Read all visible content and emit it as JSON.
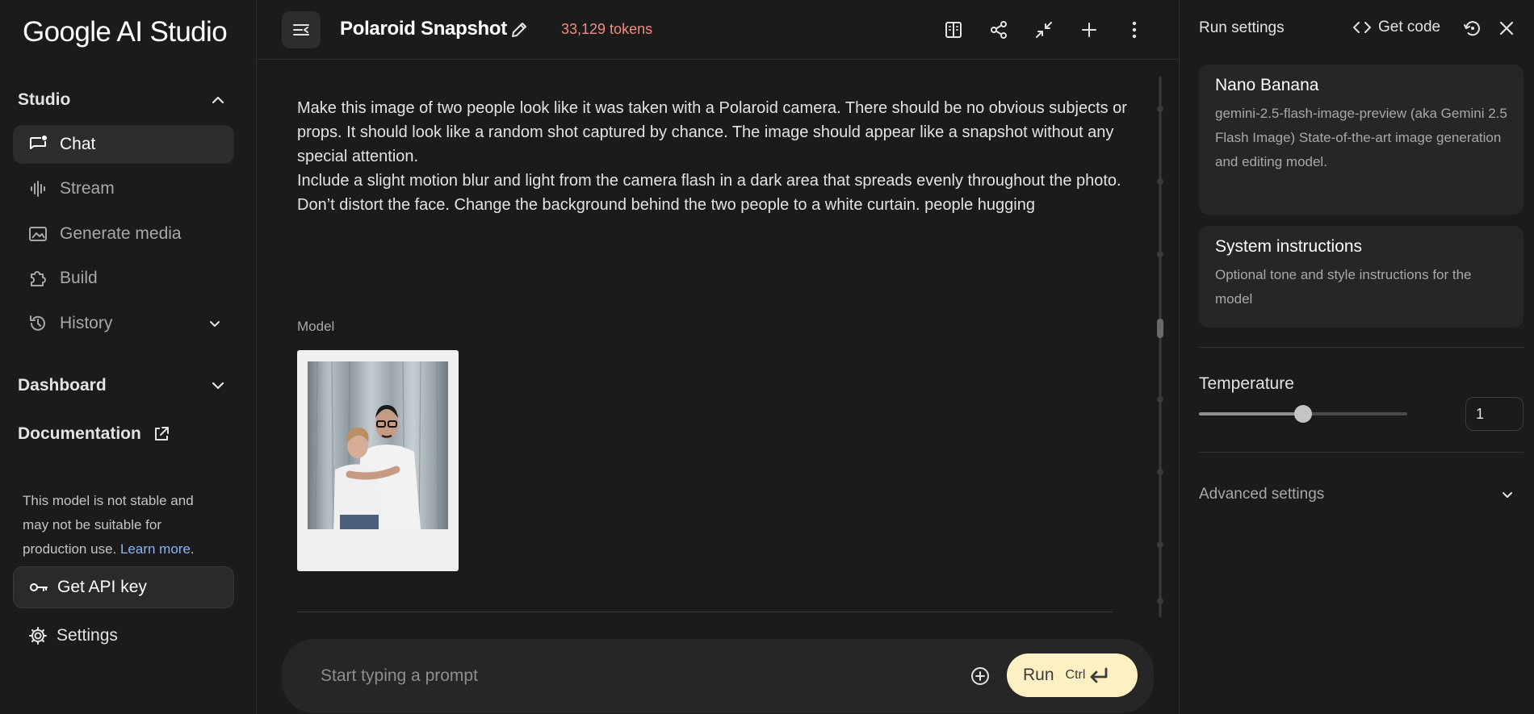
{
  "app": {
    "logo_text": "Google AI Studio"
  },
  "sidebar": {
    "studio_label": "Studio",
    "items": [
      {
        "label": "Chat",
        "icon": "chat-icon",
        "active": true
      },
      {
        "label": "Stream",
        "icon": "stream-icon"
      },
      {
        "label": "Generate media",
        "icon": "image-icon"
      },
      {
        "label": "Build",
        "icon": "puzzle-icon"
      },
      {
        "label": "History",
        "icon": "history-icon"
      }
    ],
    "dashboard_label": "Dashboard",
    "documentation_label": "Documentation",
    "notice_text": "This model is not stable and may not be suitable for production use. ",
    "notice_link": "Learn more",
    "notice_period": ".",
    "api_key_label": "Get API key",
    "settings_label": "Settings"
  },
  "topbar": {
    "title": "Polaroid Snapshot",
    "tokens": "33,129 tokens",
    "actions": [
      "compare-icon",
      "share-icon",
      "collapse-icon",
      "add-icon",
      "more-vert-icon"
    ]
  },
  "chat": {
    "prompt_lines": [
      "Make this image of two people look like it was taken with a Polaroid camera. There should be no obvious subjects or props. It should look like a random shot captured by chance. The image should appear like a snapshot without any special attention.",
      "Include a slight motion blur and light from the camera flash in a dark area that spreads evenly throughout the photo. Don’t distort the face. Change the background behind the two people to a white curtain. people hugging"
    ],
    "model_label": "Model"
  },
  "input": {
    "placeholder": "Start typing a prompt",
    "run_label": "Run",
    "shortcut": "Ctrl"
  },
  "run_settings": {
    "title": "Run settings",
    "get_code_label": "Get code",
    "model_card": {
      "name": "Nano Banana",
      "description": "gemini-2.5-flash-image-preview (aka Gemini 2.5 Flash Image) State-of-the-art image generation and editing model."
    },
    "system_card": {
      "name": "System instructions",
      "description": "Optional tone and style instructions for the model"
    },
    "temperature_label": "Temperature",
    "temperature_value": "1",
    "temperature_fraction": 0.5,
    "advanced_label": "Advanced settings"
  },
  "colors": {
    "accent_run": "#fdf1c4",
    "tokens": "#f28b82",
    "link": "#8ab4f8"
  }
}
